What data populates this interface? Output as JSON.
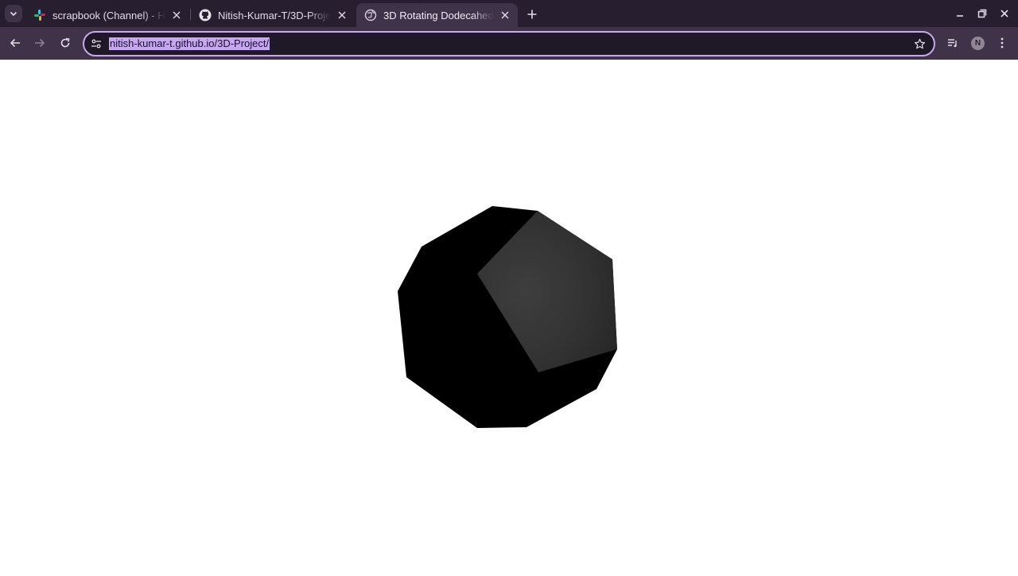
{
  "tabs": [
    {
      "title": "scrapbook (Channel) - Ha",
      "favicon": "slack-icon",
      "active": false
    },
    {
      "title": "Nitish-Kumar-T/3D-Proje",
      "favicon": "github-icon",
      "active": false
    },
    {
      "title": "3D Rotating Dodecahedr",
      "favicon": "globe-icon",
      "active": true
    }
  ],
  "toolbar": {
    "url": "nitish-kumar-t.github.io/3D-Project/",
    "profile_initial": "N"
  },
  "colors": {
    "tabstrip_bg": "#271f30",
    "toolbar_bg": "#3f3249",
    "omnibox_border": "#c9a8f0",
    "url_selection": "#c7a7f3",
    "dodecahedron_dark": "#000000",
    "dodecahedron_lit_face": "#3a3a3a"
  },
  "icons": [
    "tab-search-icon",
    "close-icon",
    "new-tab-icon",
    "minimize-icon",
    "restore-icon",
    "window-close-icon",
    "back-icon",
    "forward-icon",
    "reload-icon",
    "site-settings-icon",
    "bookmark-star-icon",
    "media-controls-icon",
    "more-menu-icon"
  ]
}
